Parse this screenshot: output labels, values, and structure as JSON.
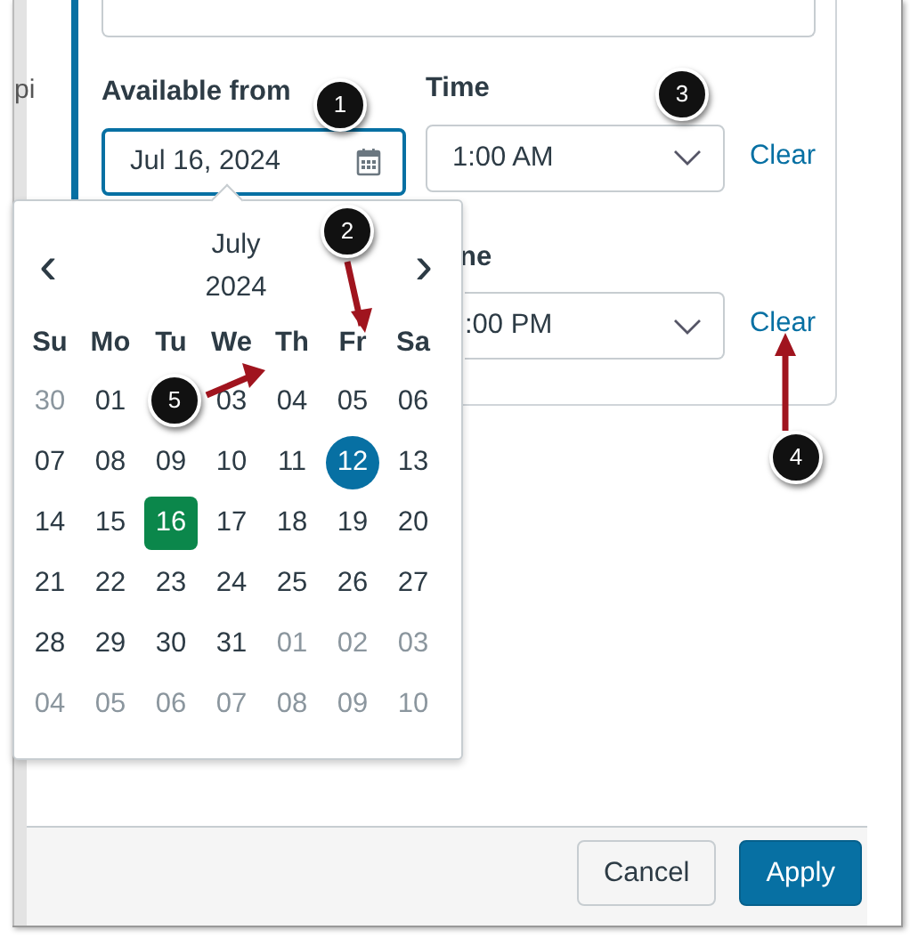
{
  "sidebar": {
    "text": "pi"
  },
  "form": {
    "available_from": {
      "label": "Available from",
      "value": "Jul 16, 2024"
    },
    "time": {
      "label": "Time",
      "value": "1:00 AM",
      "clear": "Clear"
    },
    "until_time": {
      "label": "ne",
      "value": ":00 PM",
      "clear": "Clear"
    }
  },
  "date_picker": {
    "month": "July",
    "year": "2024",
    "prev": "‹",
    "next": "›",
    "weekdays": [
      "Su",
      "Mo",
      "Tu",
      "We",
      "Th",
      "Fr",
      "Sa"
    ],
    "days": [
      {
        "label": "30",
        "outside": true,
        "selected": false,
        "today": false
      },
      {
        "label": "01",
        "outside": false,
        "selected": false,
        "today": false
      },
      {
        "label": "03",
        "outside": false,
        "selected": false,
        "today": false,
        "gap_before": true
      },
      {
        "label": "04",
        "outside": false,
        "selected": false,
        "today": false
      },
      {
        "label": "05",
        "outside": false,
        "selected": false,
        "today": false
      },
      {
        "label": "06",
        "outside": false,
        "selected": false,
        "today": false
      },
      {
        "label": "07",
        "outside": false,
        "selected": false,
        "today": false
      },
      {
        "label": "08",
        "outside": false,
        "selected": false,
        "today": false
      },
      {
        "label": "09",
        "outside": false,
        "selected": false,
        "today": false
      },
      {
        "label": "10",
        "outside": false,
        "selected": false,
        "today": false
      },
      {
        "label": "11",
        "outside": false,
        "selected": false,
        "today": false
      },
      {
        "label": "12",
        "outside": false,
        "selected": false,
        "today": true
      },
      {
        "label": "13",
        "outside": false,
        "selected": false,
        "today": false
      },
      {
        "label": "14",
        "outside": false,
        "selected": false,
        "today": false
      },
      {
        "label": "15",
        "outside": false,
        "selected": false,
        "today": false
      },
      {
        "label": "16",
        "outside": false,
        "selected": true,
        "today": false
      },
      {
        "label": "17",
        "outside": false,
        "selected": false,
        "today": false
      },
      {
        "label": "18",
        "outside": false,
        "selected": false,
        "today": false
      },
      {
        "label": "19",
        "outside": false,
        "selected": false,
        "today": false
      },
      {
        "label": "20",
        "outside": false,
        "selected": false,
        "today": false
      },
      {
        "label": "21",
        "outside": false,
        "selected": false,
        "today": false
      },
      {
        "label": "22",
        "outside": false,
        "selected": false,
        "today": false
      },
      {
        "label": "23",
        "outside": false,
        "selected": false,
        "today": false
      },
      {
        "label": "24",
        "outside": false,
        "selected": false,
        "today": false
      },
      {
        "label": "25",
        "outside": false,
        "selected": false,
        "today": false
      },
      {
        "label": "26",
        "outside": false,
        "selected": false,
        "today": false
      },
      {
        "label": "27",
        "outside": false,
        "selected": false,
        "today": false
      },
      {
        "label": "28",
        "outside": false,
        "selected": false,
        "today": false
      },
      {
        "label": "29",
        "outside": false,
        "selected": false,
        "today": false
      },
      {
        "label": "30",
        "outside": false,
        "selected": false,
        "today": false
      },
      {
        "label": "31",
        "outside": false,
        "selected": false,
        "today": false
      },
      {
        "label": "01",
        "outside": true,
        "selected": false,
        "today": false
      },
      {
        "label": "02",
        "outside": true,
        "selected": false,
        "today": false
      },
      {
        "label": "03",
        "outside": true,
        "selected": false,
        "today": false
      },
      {
        "label": "04",
        "outside": true,
        "selected": false,
        "today": false
      },
      {
        "label": "05",
        "outside": true,
        "selected": false,
        "today": false
      },
      {
        "label": "06",
        "outside": true,
        "selected": false,
        "today": false
      },
      {
        "label": "07",
        "outside": true,
        "selected": false,
        "today": false
      },
      {
        "label": "08",
        "outside": true,
        "selected": false,
        "today": false
      },
      {
        "label": "09",
        "outside": true,
        "selected": false,
        "today": false
      },
      {
        "label": "10",
        "outside": true,
        "selected": false,
        "today": false
      }
    ]
  },
  "buttons": [
    {
      "label": "Cancel",
      "kind": "secondary"
    },
    {
      "label": "Apply",
      "kind": "primary"
    }
  ],
  "callouts": [
    {
      "number": "1",
      "kind": "plain"
    },
    {
      "number": "2",
      "kind": "down"
    },
    {
      "number": "3",
      "kind": "plain"
    },
    {
      "number": "4",
      "kind": "up"
    },
    {
      "number": "5",
      "kind": "right"
    }
  ]
}
